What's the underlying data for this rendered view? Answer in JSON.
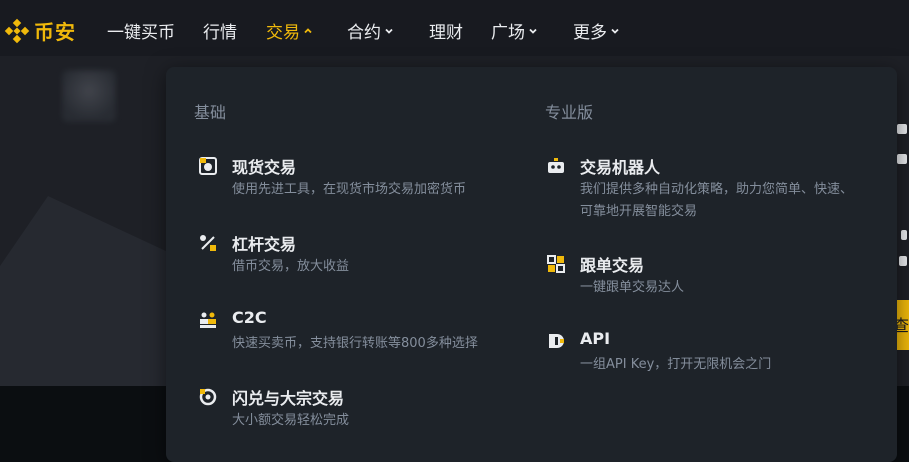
{
  "brand": {
    "name": "币安",
    "color": "#f0b90b"
  },
  "nav": {
    "items": [
      {
        "label": "一键买币",
        "has_dropdown": false,
        "active": false
      },
      {
        "label": "行情",
        "has_dropdown": false,
        "active": false
      },
      {
        "label": "交易",
        "has_dropdown": true,
        "active": true
      },
      {
        "label": "合约",
        "has_dropdown": true,
        "active": false
      },
      {
        "label": "理财",
        "has_dropdown": false,
        "active": false
      },
      {
        "label": "广场",
        "has_dropdown": true,
        "active": false
      },
      {
        "label": "更多",
        "has_dropdown": true,
        "active": false
      }
    ]
  },
  "trade_menu": {
    "basic": {
      "title": "基础",
      "items": [
        {
          "icon": "spot-icon",
          "title": "现货交易",
          "desc": "使用先进工具，在现货市场交易加密货币"
        },
        {
          "icon": "margin-icon",
          "title": "杠杆交易",
          "desc": "借币交易，放大收益"
        },
        {
          "icon": "c2c-icon",
          "title": "C2C",
          "desc": "快速买卖币，支持银行转账等800多种选择"
        },
        {
          "icon": "convert-icon",
          "title": "闪兑与大宗交易",
          "desc": "大小额交易轻松完成"
        }
      ]
    },
    "pro": {
      "title": "专业版",
      "items": [
        {
          "icon": "bot-icon",
          "title": "交易机器人",
          "desc": "我们提供多种自动化策略，助力您简单、快速、可靠地开展智能交易"
        },
        {
          "icon": "copy-trading-icon",
          "title": "跟单交易",
          "desc": "一键跟单交易达人"
        },
        {
          "icon": "api-icon",
          "title": "API",
          "desc": "一组API Key，打开无限机会之门"
        }
      ]
    }
  },
  "background_fragment": {
    "right_edge_text": "查"
  },
  "colors": {
    "accent": "#f0b90b",
    "panel": "#1e2329",
    "muted": "#848e9c",
    "text": "#eaecef"
  }
}
